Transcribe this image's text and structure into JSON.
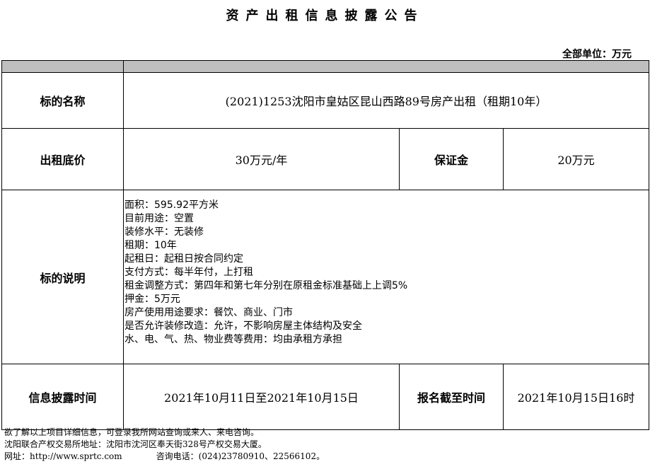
{
  "title": "资产出租信息披露公告",
  "unit": "全部单位：万元",
  "rows": {
    "name": {
      "label": "标的名称",
      "value": "(2021)1253沈阳市皇姑区昆山西路89号房产出租（租期10年）"
    },
    "price": {
      "label": "出租底价",
      "value": "30万元/年",
      "deposit_label": "保证金",
      "deposit_value": "20万元"
    },
    "description": {
      "label": "标的说明",
      "lines": [
        "面积：595.92平方米",
        "目前用途：空置",
        "装修水平：无装修",
        "租期：10年",
        "起租日：起租日按合同约定",
        "支付方式：每半年付，上打租",
        "租金调整方式：第四年和第七年分别在原租金标准基础上上调5%",
        "押金：5万元",
        "房产使用用途要求：餐饮、商业、门市",
        "是否允许装修改造：允许，不影响房屋主体结构及安全",
        "水、电、气、热、物业费等费用：均由承租方承担"
      ]
    },
    "time": {
      "label": "信息披露时间",
      "value": "2021年10月11日至2021年10月15日",
      "deadline_label": "报名截至时间",
      "deadline_value": "2021年10月15日16时"
    }
  },
  "footer": {
    "line1": "欲了解以上项目详细信息，可登录我所网站查询或来人、来电咨询。",
    "line2": "沈阳联合产权交易所地址：沈阳市沈河区奉天街328号产权交易大厦。",
    "website": "网址：http://www.sprtc.com",
    "phone": "咨询电话：(024)23780910、22566102。"
  }
}
